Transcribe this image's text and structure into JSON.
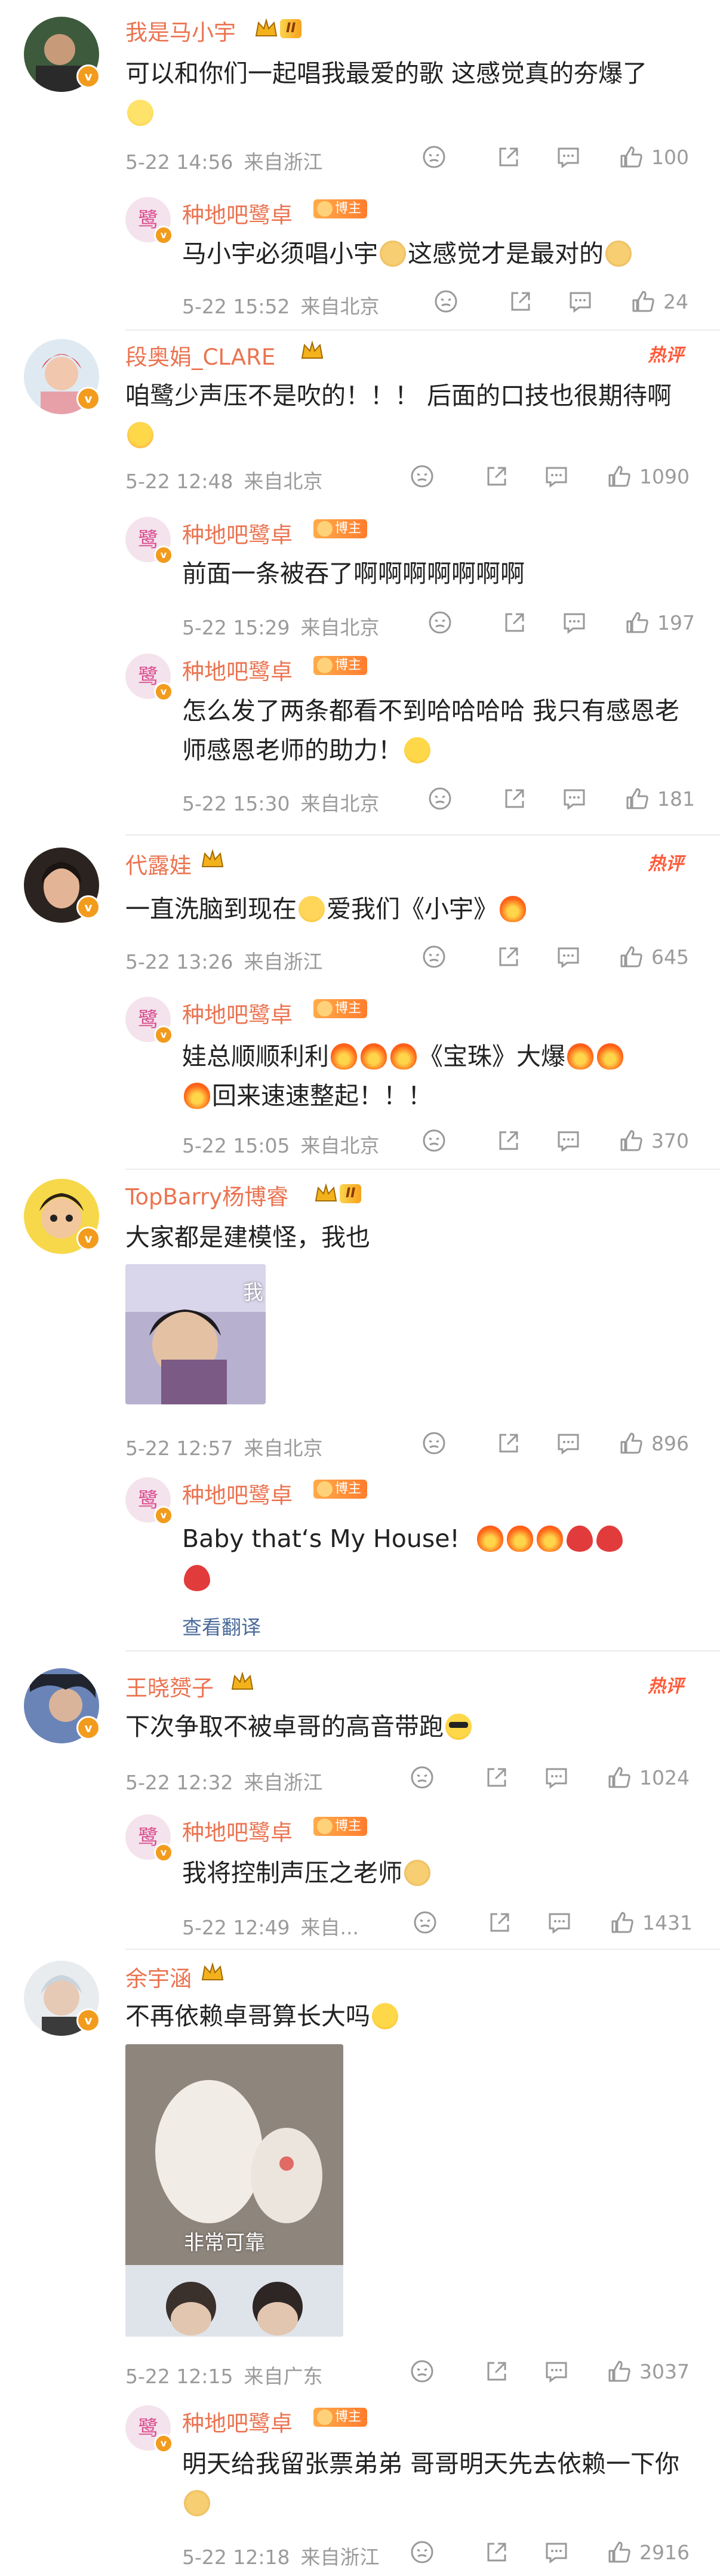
{
  "labels": {
    "like_icon": "thumbs-up-icon",
    "hot_label": "热评"
  },
  "badges": {
    "level_ii": "II",
    "blogger": "博主"
  },
  "comments": [
    {
      "user": "我是马小宇",
      "text": "可以和你们一起唱我最爱的歌 这感觉真的夯爆了",
      "date": "5-22 14:56",
      "location": "来自浙江",
      "likes": "100",
      "reply": {
        "user": "种地吧鹭卓",
        "text_a": "马小宇必须唱小宇",
        "text_b": "这感觉才是最对的",
        "date": "5-22 15:52",
        "location": "来自北京",
        "likes": "24"
      }
    },
    {
      "user": "段奥娟_CLARE",
      "hot": true,
      "text": "咱鹭少声压不是吹的！！！ 后面的口技也很期待啊",
      "date": "5-22 12:48",
      "location": "来自北京",
      "likes": "1090",
      "replies": [
        {
          "user": "种地吧鹭卓",
          "text": "前面一条被吞了啊啊啊啊啊啊啊",
          "date": "5-22 15:29",
          "location": "来自北京",
          "likes": "197"
        },
        {
          "user": "种地吧鹭卓",
          "text": "怎么发了两条都看不到哈哈哈哈 我只有感恩老师感恩老师的助力！",
          "date": "5-22 15:30",
          "location": "来自北京",
          "likes": "181"
        }
      ]
    },
    {
      "user": "代露娃",
      "hot": true,
      "text_a": "一直洗脑到现在",
      "text_b": "爱我们《小宇》",
      "date": "5-22 13:26",
      "location": "来自浙江",
      "likes": "645",
      "reply": {
        "user": "种地吧鹭卓",
        "text_a": "娃总顺顺利利",
        "text_b": "《宝珠》大爆",
        "text_c": "回来速速整起！！！",
        "date": "5-22 15:05",
        "location": "来自北京",
        "likes": "370"
      }
    },
    {
      "user": "TopBarry杨博睿",
      "text": "大家都是建模怪，我也",
      "image_caption": "我",
      "date": "5-22 12:57",
      "location": "来自北京",
      "likes": "896",
      "reply": {
        "user": "种地吧鹭卓",
        "text": "Baby that‘s My House!",
        "translate": "查看翻译"
      }
    },
    {
      "user": "王晓赟子",
      "hot": true,
      "text": "下次争取不被卓哥的高音带跑",
      "date": "5-22 12:32",
      "location": "来自浙江",
      "likes": "1024",
      "reply": {
        "user": "种地吧鹭卓",
        "text": "我将控制声压之老师",
        "date": "5-22 12:49",
        "location": "来自...",
        "likes": "1431"
      }
    },
    {
      "user": "余宇涵",
      "text": "不再依赖卓哥算长大吗",
      "image_caption": "非常可靠",
      "date": "5-22 12:15",
      "location": "来自广东",
      "likes": "3037",
      "reply": {
        "user": "种地吧鹭卓",
        "text": "明天给我留张票弟弟 哥哥明天先去依赖一下你",
        "date": "5-22 12:18",
        "location": "来自浙江",
        "likes": "2916"
      }
    }
  ]
}
